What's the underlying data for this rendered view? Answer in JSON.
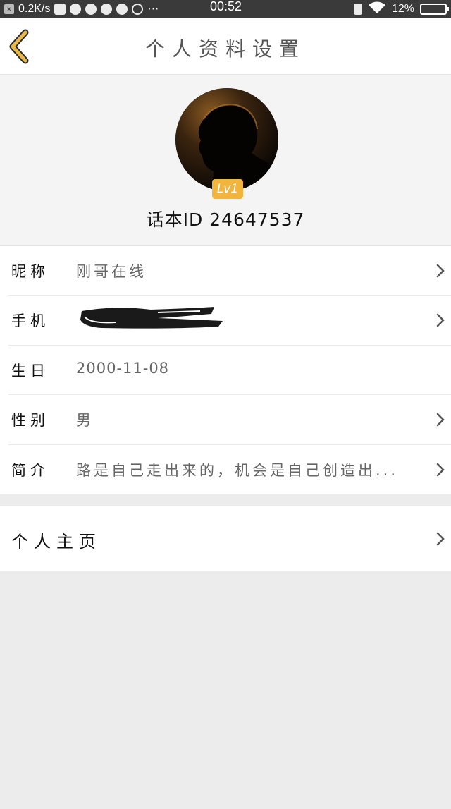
{
  "status_bar": {
    "net_speed": "0.2K/s",
    "time": "00:52",
    "battery": "12%"
  },
  "header": {
    "title": "个人资料设置"
  },
  "profile": {
    "level": "Lv1",
    "user_id": "话本ID 24647537"
  },
  "info": {
    "rows": [
      {
        "label": "昵称",
        "value": "刚哥在线"
      },
      {
        "label": "手机",
        "value": ""
      },
      {
        "label": "生日",
        "value": "2000-11-08"
      },
      {
        "label": "性别",
        "value": "男"
      },
      {
        "label": "简介",
        "value": "路是自己走出来的，机会是自己创造出..."
      }
    ]
  },
  "homepage": {
    "label": "个人主页"
  },
  "colors": {
    "accent": "#f2b43c",
    "back_arrow": "#e8b84a",
    "background": "#ececec"
  }
}
